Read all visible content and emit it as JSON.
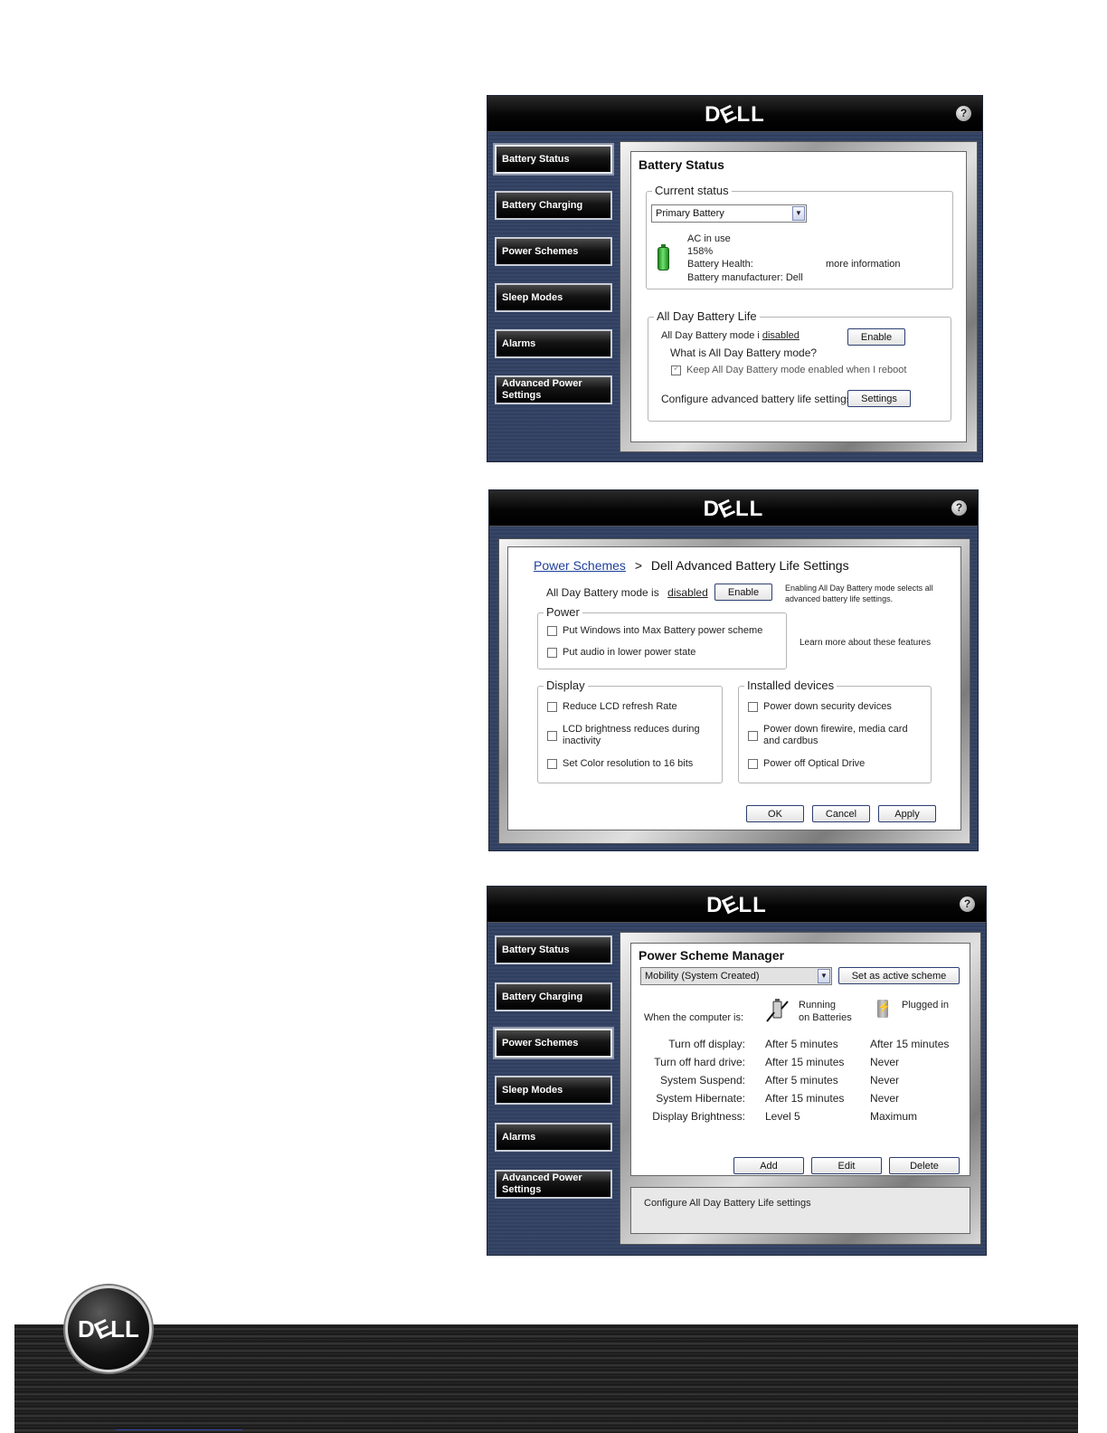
{
  "brand": {
    "logo_text_d": "D",
    "logo_text_e": "E",
    "logo_text_ll": "LL",
    "help": "?"
  },
  "nav": {
    "battery_status": "Battery Status",
    "battery_charging": "Battery Charging",
    "power_schemes": "Power Schemes",
    "sleep_modes": "Sleep Modes",
    "alarms": "Alarms",
    "advanced_power_line1": "Advanced Power",
    "advanced_power_line2": "Settings"
  },
  "battery_status": {
    "title": "Battery Status",
    "current_status_legend": "Current status",
    "battery_select": "Primary Battery",
    "ac_in_use": "AC in use",
    "percent": "158%",
    "health_label": "Battery Health:",
    "more_information": "more information",
    "manufacturer": "Battery manufacturer:  Dell",
    "all_day_legend": "All Day Battery Life",
    "mode_text": "All Day Battery mode i ",
    "mode_state": "disabled",
    "enable_button": "Enable",
    "what_is_link": "What is All Day Battery mode?",
    "keep_enabled": "Keep All Day Battery mode enabled when I reboot",
    "configure_text": "Configure advanced battery life settings",
    "settings_button": "Settings"
  },
  "advanced_settings": {
    "breadcrumb_link": "Power Schemes",
    "breadcrumb_sep": ">",
    "breadcrumb_title": "Dell Advanced Battery Life Settings",
    "mode_text": "All Day Battery mode is",
    "mode_state": "disabled",
    "enable_button": "Enable",
    "enable_note": "Enabling All Day Battery mode selects all advanced battery life settings.",
    "power_legend": "Power",
    "put_windows": "Put Windows into Max Battery power scheme",
    "put_audio": "Put audio in lower power state",
    "learn_more": "Learn more about these features",
    "display_legend": "Display",
    "reduce_lcd": "Reduce LCD refresh Rate",
    "lcd_brightness": "LCD brightness reduces during inactivity",
    "color_resolution": "Set Color resolution to 16 bits",
    "devices_legend": "Installed devices",
    "security_devices": "Power down security devices",
    "firewire": "Power down firewire, media card and cardbus",
    "optical": "Power off Optical Drive",
    "ok_button": "OK",
    "cancel_button": "Cancel",
    "apply_button": "Apply"
  },
  "power_scheme_manager": {
    "title": "Power Scheme Manager",
    "scheme_select": "Mobility (System Created)",
    "set_active_button": "Set as active scheme",
    "when_label": "When the computer is:",
    "running_line1": "Running",
    "running_line2": "on Batteries",
    "plugged_in": "Plugged in",
    "rows": [
      {
        "label": "Turn off display:",
        "battery": "After 5 minutes",
        "plugged": "After 15 minutes"
      },
      {
        "label": "Turn off hard drive:",
        "battery": "After 15 minutes",
        "plugged": "Never"
      },
      {
        "label": "System Suspend:",
        "battery": "After 5 minutes",
        "plugged": "Never"
      },
      {
        "label": "System Hibernate:",
        "battery": "After 15 minutes",
        "plugged": "Never"
      },
      {
        "label": "Display Brightness:",
        "battery": "Level 5",
        "plugged": "Maximum"
      }
    ],
    "add_button": "Add",
    "edit_button": "Edit",
    "delete_button": "Delete",
    "configure_link": "Configure All Day Battery Life settings"
  },
  "colors": {
    "link": "#1f3f9a",
    "window_bg": "#2e3d5e",
    "header": "#000000"
  }
}
